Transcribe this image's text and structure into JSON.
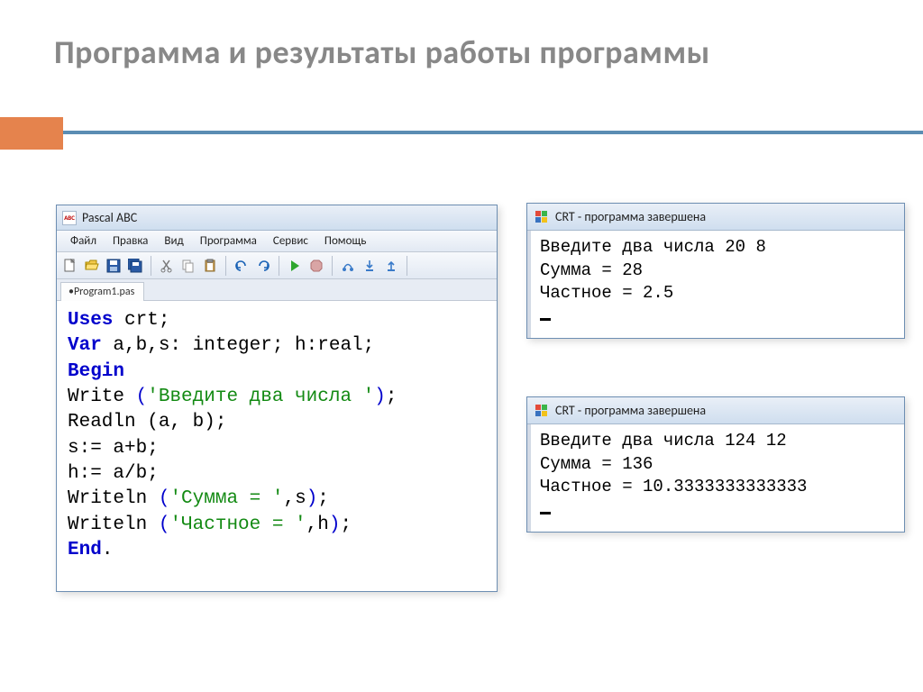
{
  "slide": {
    "title": "Программа и результаты работы программы"
  },
  "ide": {
    "app_title": "Pascal ABC",
    "app_icon_text": "ABC",
    "menu": {
      "file": "Файл",
      "edit": "Правка",
      "view": "Вид",
      "program": "Программа",
      "service": "Сервис",
      "help": "Помощь"
    },
    "tab": "•Program1.pas",
    "code": {
      "uses": "Uses",
      "crt": " crt;",
      "var": "Var",
      "var_rest": " a,b,s: integer; h:real;",
      "begin": "Begin",
      "l4_a": "Write ",
      "l4_b": "(",
      "l4_c": "'Введите два числа '",
      "l4_d": ")",
      "l4_e": ";",
      "l5": "Readln (a, b);",
      "l6": "s:= a+b;",
      "l7": "h:= a/b;",
      "l8_a": "Writeln ",
      "l8_b": "(",
      "l8_c": "'Сумма = '",
      "l8_d": ",s",
      "l8_e": ")",
      "l8_f": ";",
      "l9_a": "Writeln ",
      "l9_b": "(",
      "l9_c": "'Частное = '",
      "l9_d": ",h",
      "l9_e": ")",
      "l9_f": ";",
      "end": "End",
      "end_dot": "."
    }
  },
  "crt_title": "CRT - программа завершена",
  "crt1": {
    "line1": "Введите два числа 20 8",
    "line2": "Сумма = 28",
    "line3": "Частное = 2.5"
  },
  "crt2": {
    "line1": "Введите два числа 124 12",
    "line2": "Сумма = 136",
    "line3": "Частное = 10.3333333333333"
  }
}
